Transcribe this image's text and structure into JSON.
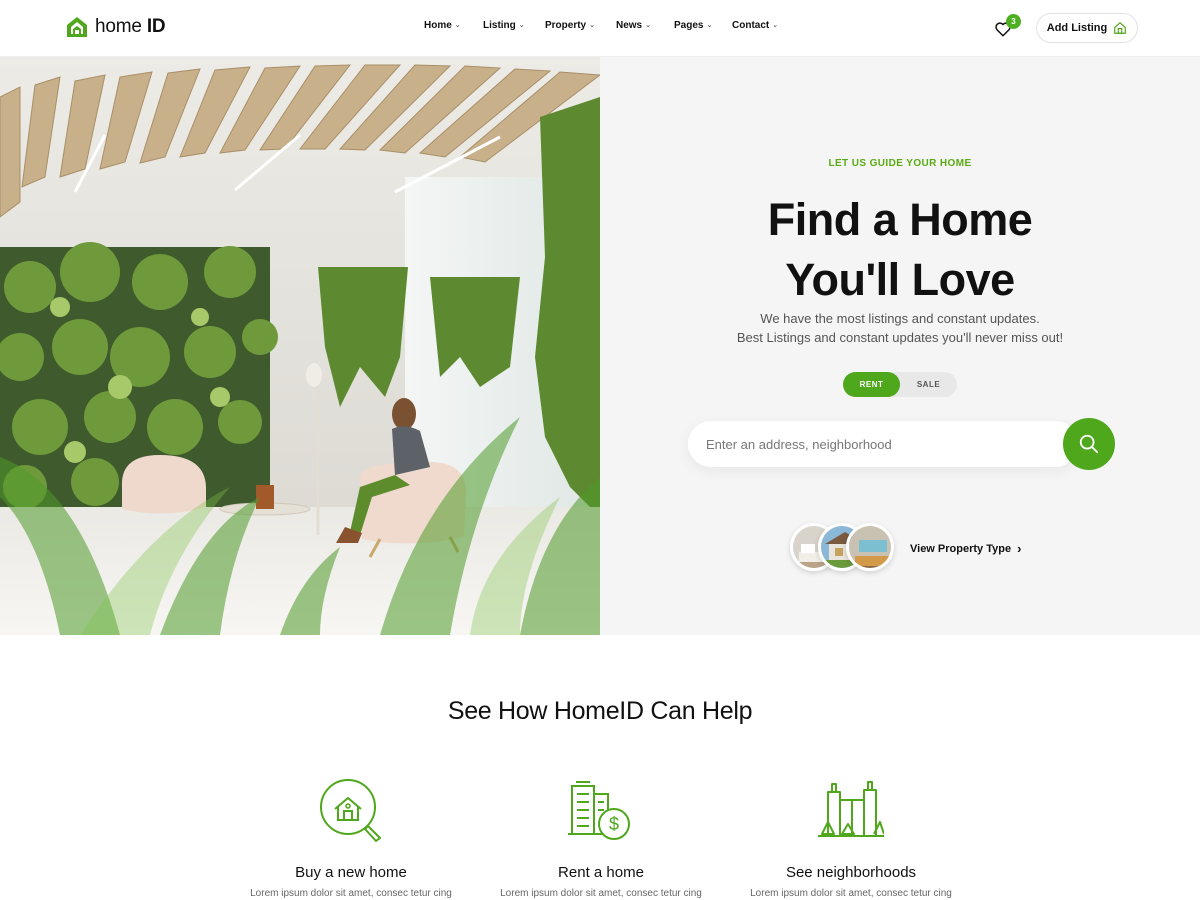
{
  "header": {
    "logo": {
      "home": "home",
      "id": "ID"
    },
    "nav": [
      "Home",
      "Listing",
      "Property",
      "News",
      "Pages",
      "Contact"
    ],
    "wishlist_count": "3",
    "add_listing_label": "Add Listing"
  },
  "hero": {
    "eyebrow": "LET US GUIDE YOUR HOME",
    "title_line1": "Find a Home",
    "title_line2": "You'll Love",
    "subtitle_line1": "We have the most listings and constant updates.",
    "subtitle_line2": "Best Listings and constant updates you'll never miss out!",
    "toggle": {
      "rent": "RENT",
      "sale": "SALE",
      "active": "rent"
    },
    "search_placeholder": "Enter an address, neighborhood",
    "view_property_type": "View Property Type"
  },
  "help": {
    "title": "See How HomeID Can Help",
    "features": [
      {
        "icon": "house-search-icon",
        "title": "Buy a new home",
        "desc": "Lorem ipsum dolor sit amet, consec tetur cing"
      },
      {
        "icon": "buildings-dollar-icon",
        "title": "Rent a home",
        "desc": "Lorem ipsum dolor sit amet, consec tetur cing"
      },
      {
        "icon": "city-trees-icon",
        "title": "See neighborhoods",
        "desc": "Lorem ipsum dolor sit amet, consec tetur cing"
      }
    ]
  },
  "colors": {
    "accent": "#4fa71c",
    "eyebrow": "#5aaa14",
    "hero_bg": "#f5f5f5"
  }
}
